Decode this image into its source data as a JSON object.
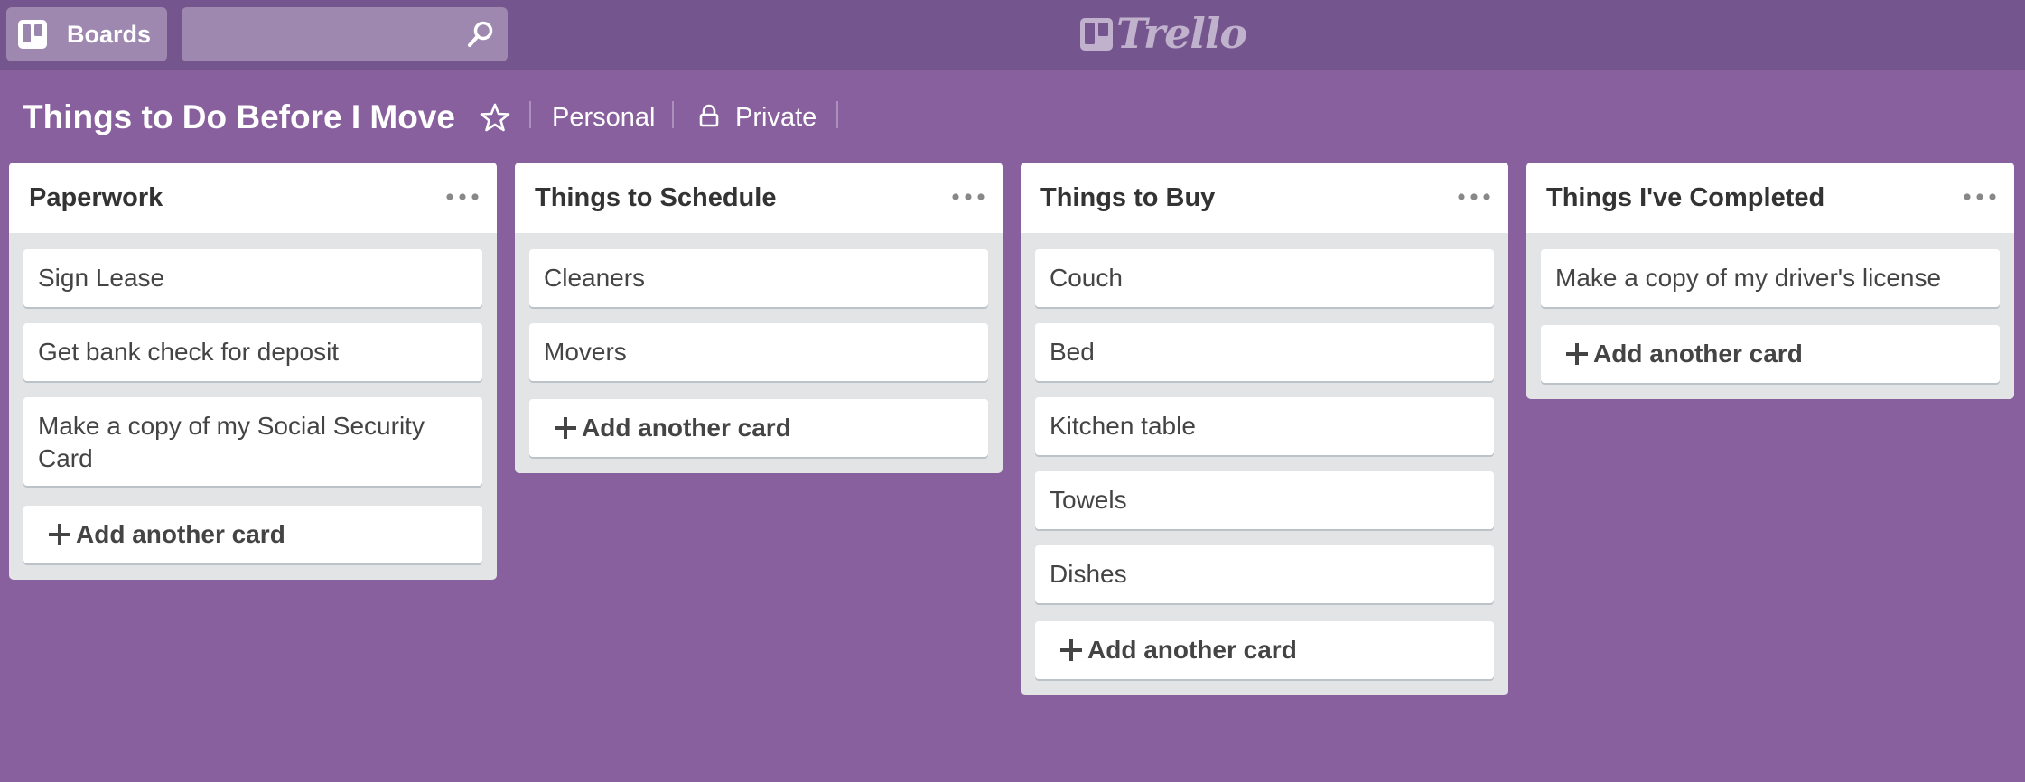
{
  "topbar": {
    "boards_label": "Boards",
    "search_placeholder": "",
    "logo_text": "Trello",
    "icons": [
      "boards-icon",
      "search-icon",
      "trello-logo-icon"
    ]
  },
  "board": {
    "title": "Things to Do Before I Move",
    "team": "Personal",
    "visibility": "Private",
    "icons": [
      "star-icon",
      "lock-icon"
    ]
  },
  "colors": {
    "background": "#89609e",
    "topbar": "#74558e",
    "list": "#e3e4e6",
    "card": "#ffffff"
  },
  "lists": [
    {
      "title": "Paperwork",
      "cards": [
        "Sign Lease",
        "Get bank check for deposit",
        "Make a copy of my Social Security Card"
      ],
      "add_label": "Add another card"
    },
    {
      "title": "Things to Schedule",
      "cards": [
        "Cleaners",
        "Movers"
      ],
      "add_label": "Add another card"
    },
    {
      "title": "Things to Buy",
      "cards": [
        "Couch",
        "Bed",
        "Kitchen table",
        "Towels",
        "Dishes"
      ],
      "add_label": "Add another card"
    },
    {
      "title": "Things I've Completed",
      "cards": [
        "Make a copy of my driver's license"
      ],
      "add_label": "Add another card"
    }
  ]
}
